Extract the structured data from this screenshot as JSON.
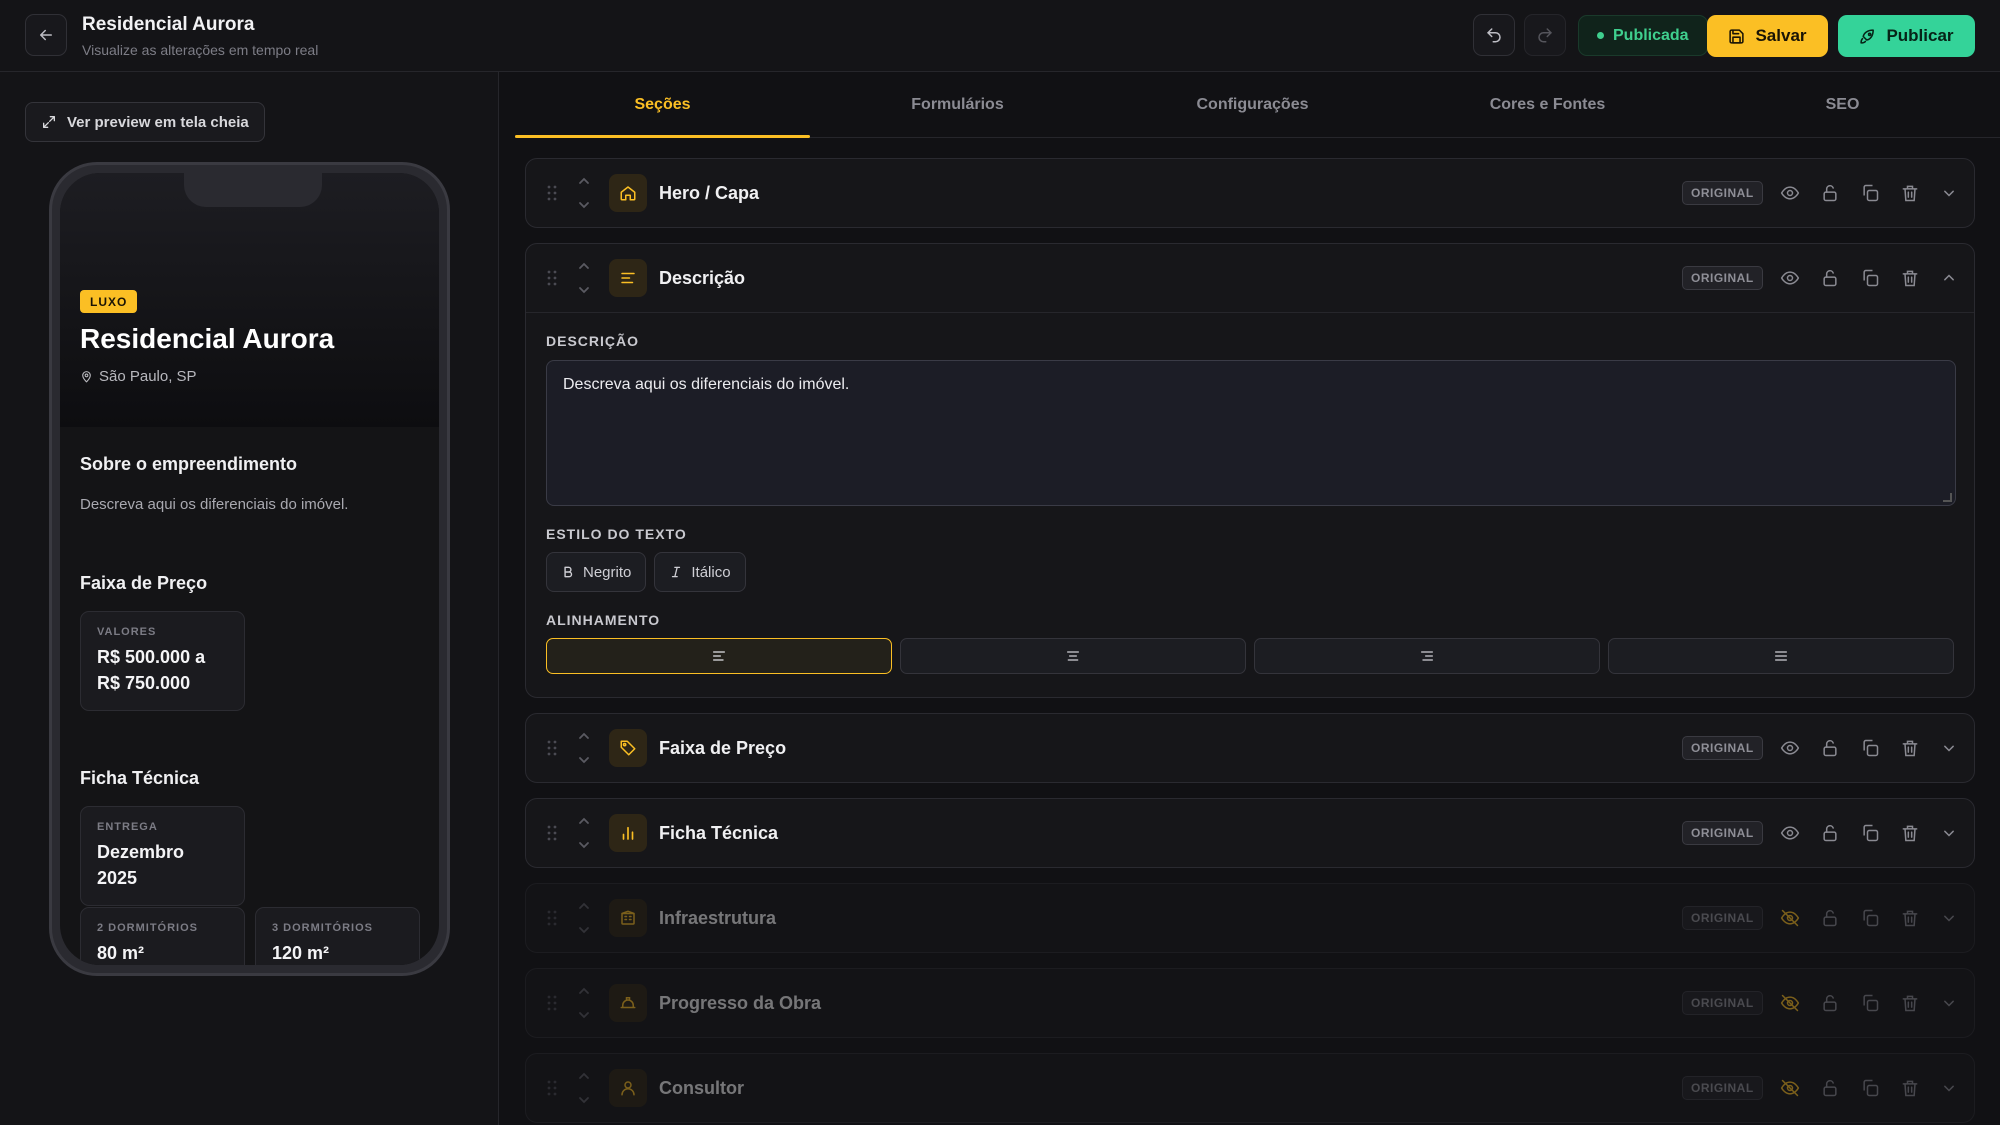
{
  "header": {
    "title": "Residencial Aurora",
    "subtitle": "Visualize as alterações em tempo real",
    "status": "Publicada",
    "save_label": "Salvar",
    "publish_label": "Publicar"
  },
  "preview": {
    "fullscreen_label": "Ver preview em tela cheia",
    "badge": "LUXO",
    "title": "Residencial Aurora",
    "location": "São Paulo, SP",
    "about_heading": "Sobre o empreendimento",
    "about_text": "Descreva aqui os diferenciais do imóvel.",
    "price_heading": "Faixa de Preço",
    "price_label": "VALORES",
    "price_value": "R$ 500.000 a R$ 750.000",
    "tech_heading": "Ficha Técnica",
    "cards": [
      {
        "label": "ENTREGA",
        "value": "Dezembro 2025"
      },
      {
        "label": "2 DORMITÓRIOS",
        "value": "80 m²"
      },
      {
        "label": "3 DORMITÓRIOS",
        "value": "120 m²"
      }
    ]
  },
  "tabs": [
    {
      "label": "Seções"
    },
    {
      "label": "Formulários"
    },
    {
      "label": "Configurações"
    },
    {
      "label": "Cores e Fontes"
    },
    {
      "label": "SEO"
    }
  ],
  "badge_original": "ORIGINAL",
  "sections": [
    {
      "title": "Hero / Capa",
      "icon": "home-icon"
    },
    {
      "title": "Descrição",
      "icon": "text-lines-icon"
    },
    {
      "title": "Faixa de Preço",
      "icon": "tag-icon"
    },
    {
      "title": "Ficha Técnica",
      "icon": "bar-chart-icon"
    },
    {
      "title": "Infraestrutura",
      "icon": "building-icon"
    },
    {
      "title": "Progresso da Obra",
      "icon": "hard-hat-icon"
    },
    {
      "title": "Consultor",
      "icon": "user-icon"
    }
  ],
  "editor": {
    "description_label": "DESCRIÇÃO",
    "description_value": "Descreva aqui os diferenciais do imóvel.",
    "text_style_label": "ESTILO DO TEXTO",
    "bold_label": "Negrito",
    "italic_label": "Itálico",
    "alignment_label": "ALINHAMENTO"
  },
  "colors": {
    "accent": "#fbbf24",
    "success": "#34d399",
    "background": "#111114"
  }
}
